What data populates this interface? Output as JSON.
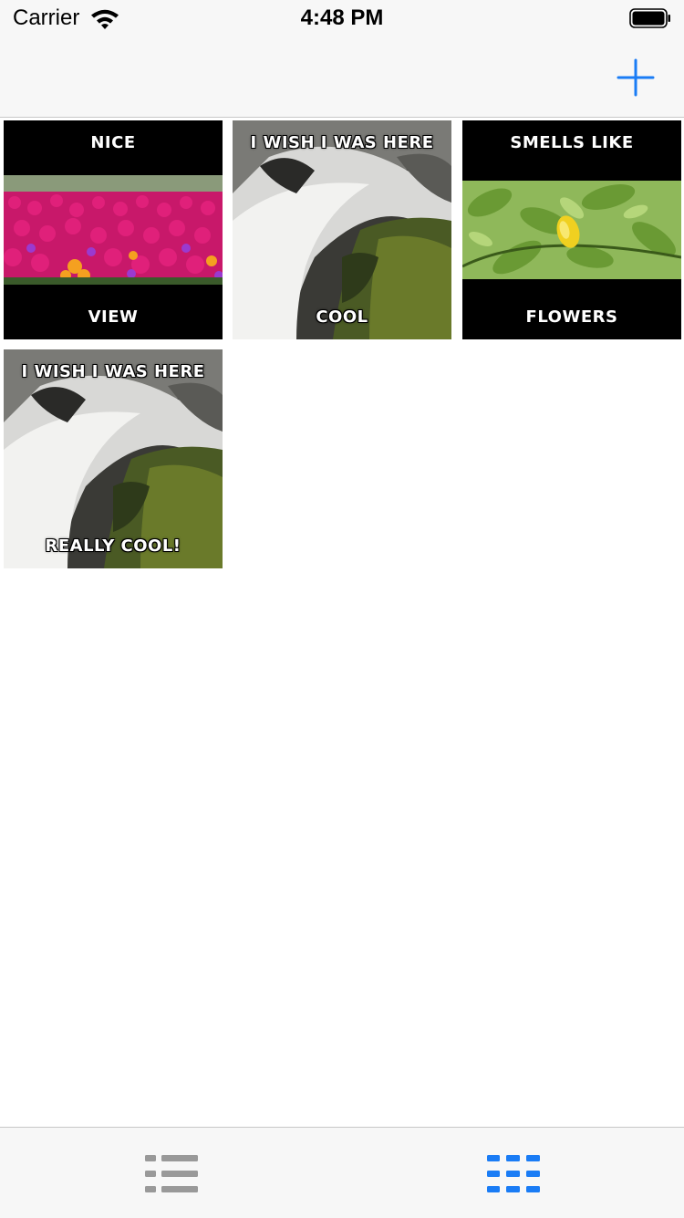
{
  "status_bar": {
    "carrier": "Carrier",
    "time": "4:48 PM",
    "wifi_icon": "wifi-icon",
    "battery_icon": "battery-icon"
  },
  "nav_bar": {
    "add_icon": "plus-icon",
    "accent_color": "#1a7cf5"
  },
  "memes": [
    {
      "top_text": "NICE",
      "bottom_text": "VIEW",
      "image": "pink-flower-field"
    },
    {
      "top_text": "I WISH I WAS HERE",
      "bottom_text": "COOL",
      "image": "waterfall"
    },
    {
      "top_text": "SMELLS LIKE",
      "bottom_text": "FLOWERS",
      "image": "green-leaves"
    },
    {
      "top_text": "I WISH I WAS HERE",
      "bottom_text": "REALLY COOL!",
      "image": "waterfall"
    }
  ],
  "tab_bar": {
    "tabs": [
      {
        "icon": "list-icon",
        "selected": false
      },
      {
        "icon": "grid-icon",
        "selected": true
      }
    ],
    "selected_color": "#1a7cf5",
    "unselected_color": "#999999"
  }
}
